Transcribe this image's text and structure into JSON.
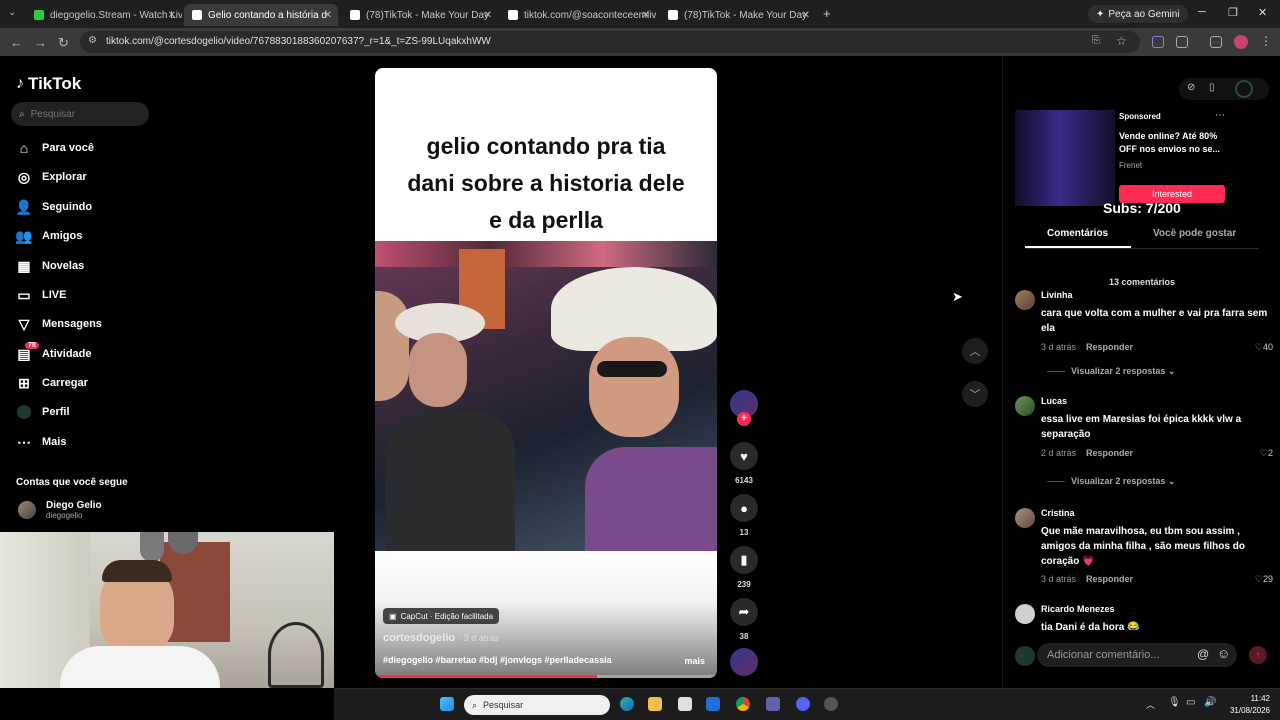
{
  "browser": {
    "tabs": [
      {
        "label": "diegogelio.Stream - Watch Live",
        "icon_color": "#2ecc40"
      },
      {
        "label": "Gelio contando a história d",
        "icon_color": "#ffffff"
      },
      {
        "label": "(78)TikTok - Make Your Day",
        "icon_color": "#ffffff"
      },
      {
        "label": "tiktok.com/@soaconteceemlive",
        "icon_color": "#ffffff"
      },
      {
        "label": "(78)TikTok - Make Your Day",
        "icon_color": "#ffffff"
      }
    ],
    "new_tab_icon": "+",
    "gemini_label": "Peça ao Gemini",
    "url": "tiktok.com/@cortesdogelio/video/7678830188360207637?_r=1&_t=ZS-99LUqakxhWW"
  },
  "sidebar": {
    "logo": "TikTok",
    "search_placeholder": "Pesquisar",
    "items": [
      {
        "label": "Para você",
        "icon": "home-icon"
      },
      {
        "label": "Explorar",
        "icon": "compass-icon"
      },
      {
        "label": "Seguindo",
        "icon": "following-icon"
      },
      {
        "label": "Amigos",
        "icon": "friends-icon"
      },
      {
        "label": "Novelas",
        "icon": "novelas-icon"
      },
      {
        "label": "LIVE",
        "icon": "live-icon"
      },
      {
        "label": "Mensagens",
        "icon": "messages-icon"
      },
      {
        "label": "Atividade",
        "icon": "activity-icon",
        "badge": "78"
      },
      {
        "label": "Carregar",
        "icon": "upload-icon"
      },
      {
        "label": "Perfil",
        "icon": "profile-icon"
      },
      {
        "label": "Mais",
        "icon": "more-icon"
      }
    ],
    "following_title": "Contas que você segue",
    "following": [
      {
        "name": "Diego Gelio",
        "handle": "diegogelio"
      }
    ]
  },
  "video": {
    "caption": "gelio contando pra tia dani sobre a historia dele e da perlla",
    "capcut_label": "CapCut · Edição facilitada",
    "author": "cortesdogelio",
    "time": "· 3 d atrás",
    "hashtags": "#diegogelio #barretao #bdj #jonvlogs #perlladecassia",
    "more_label": "mais",
    "progress": 0.65
  },
  "actions": {
    "likes": "6143",
    "comments": "13",
    "saves": "239",
    "shares": "38"
  },
  "ad": {
    "sponsored": "Sponsored",
    "text": "Vende online? Até 80% OFF nos envios no se...",
    "brand": "Frenet",
    "cta": "Interested"
  },
  "overlay": {
    "subs": "Subs: 7/200"
  },
  "panel": {
    "tab_comments": "Comentários",
    "tab_suggested": "Você pode gostar",
    "count": "13 comentários",
    "comments": [
      {
        "user": "Livinha",
        "text": "cara que volta com a mulher e vai pra farra sem ela",
        "time": "3 d atrás",
        "reply": "Responder",
        "likes": "40",
        "view_replies": "Visualizar 2 respostas"
      },
      {
        "user": "Lucas",
        "text": "essa live em Maresias foi épica kkkk vlw a separação",
        "time": "2 d atrás",
        "reply": "Responder",
        "likes": "2",
        "view_replies": "Visualizar 2 respostas"
      },
      {
        "user": "Cristina",
        "text": "Que mãe maravilhosa, eu tbm sou assim , amigos da minha filha , são meus filhos do coração 💗",
        "time": "3 d atrás",
        "reply": "Responder",
        "likes": "29"
      },
      {
        "user": "Ricardo Menezes",
        "text": "tia Dani é da hora 😂"
      }
    ],
    "input_placeholder": "Adicionar comentário..."
  },
  "taskbar": {
    "search_placeholder": "Pesquisar",
    "time": "11:42",
    "date": "31/08/2026"
  }
}
